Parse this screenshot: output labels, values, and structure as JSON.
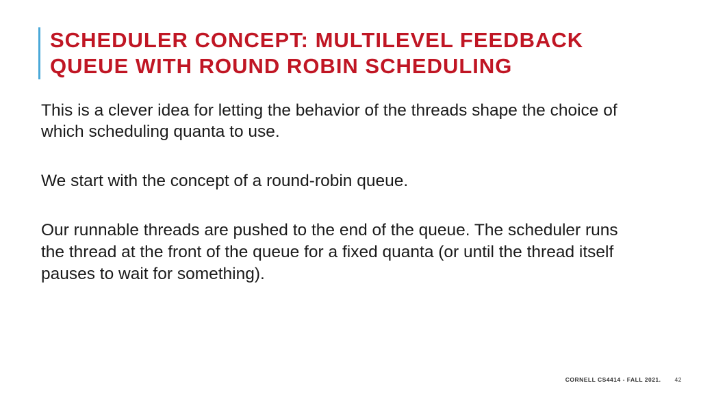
{
  "title": "SCHEDULER CONCEPT: MULTILEVEL FEEDBACK QUEUE WITH ROUND ROBIN SCHEDULING",
  "paragraphs": [
    "This is a clever idea for letting the behavior of the threads shape the choice of which scheduling quanta to use.",
    "We start with the concept of a round-robin queue.",
    "Our runnable threads are pushed to the end of the queue.  The scheduler runs the thread at the front of the queue for a fixed quanta (or until the thread itself pauses to wait for something)."
  ],
  "footer": {
    "course": "CORNELL CS4414 - FALL 2021.",
    "page": "42"
  }
}
